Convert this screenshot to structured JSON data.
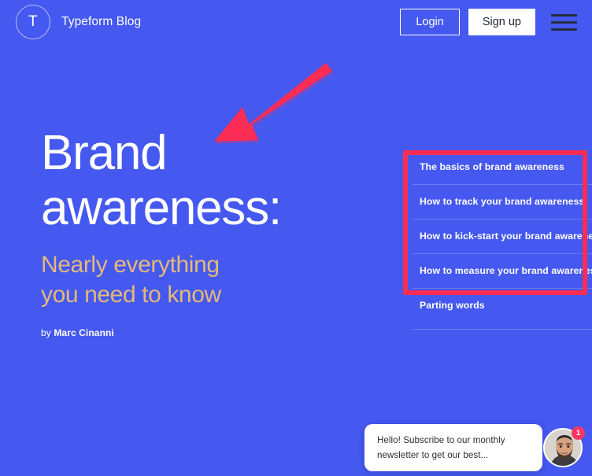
{
  "page": {
    "background_color": "#4558ef",
    "accent_gold": "#e4b97a",
    "annotation_red": "#fb2d54"
  },
  "header": {
    "logo_letter": "T",
    "brand_name": "Typeform Blog",
    "login_label": "Login",
    "signup_label": "Sign up",
    "menu_icon": "hamburger-icon"
  },
  "hero": {
    "title": "Brand\nawareness:",
    "subtitle": "Nearly everything\nyou need to know",
    "byline_prefix": "by ",
    "byline_author": "Marc Cinanni"
  },
  "annotation": {
    "arrow": "red-arrow-pointing-down-left",
    "highlight_box": "red-rectangle-around-first-four-toc-items"
  },
  "toc": {
    "items": [
      {
        "label": "The basics of brand awareness"
      },
      {
        "label": "How to track your brand awareness"
      },
      {
        "label": "How to kick-start your brand awareness"
      },
      {
        "label": "How to measure your brand awareness"
      },
      {
        "label": "Parting words"
      }
    ]
  },
  "chat": {
    "message": "Hello! Subscribe to our monthly newsletter to get our best...",
    "badge_count": "1",
    "avatar": "bearded-man-avatar"
  }
}
